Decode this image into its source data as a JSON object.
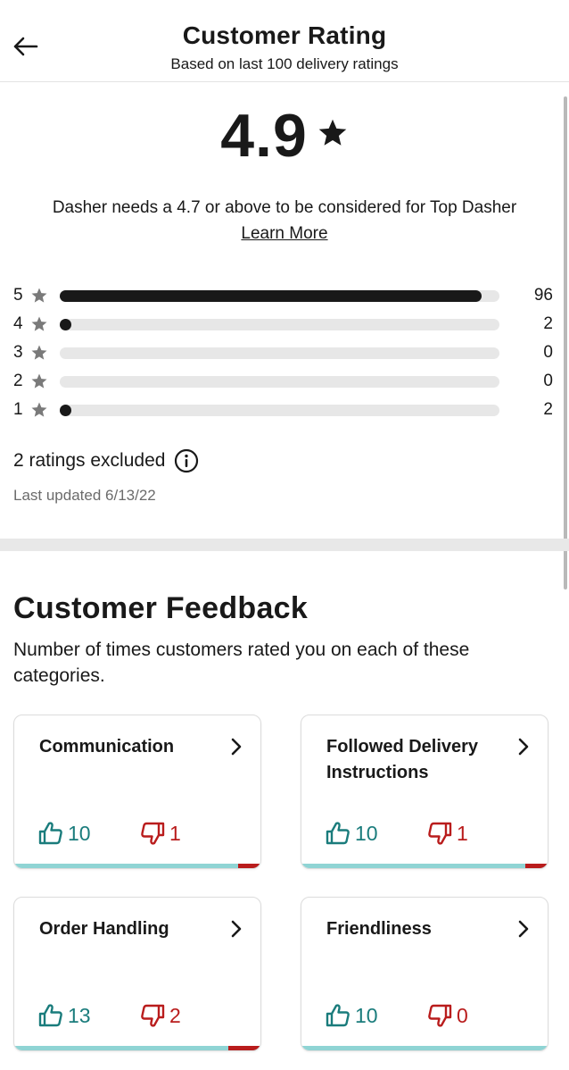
{
  "header": {
    "title": "Customer Rating",
    "subtitle": "Based on last 100 delivery ratings"
  },
  "rating": {
    "value": "4.9",
    "requirement": "Dasher needs a 4.7 or above to be considered for Top Dasher",
    "learn_more": "Learn More"
  },
  "distribution": [
    {
      "stars": "5",
      "count": "96",
      "fraction": 0.96
    },
    {
      "stars": "4",
      "count": "2",
      "fraction": 0.02
    },
    {
      "stars": "3",
      "count": "0",
      "fraction": 0
    },
    {
      "stars": "2",
      "count": "0",
      "fraction": 0
    },
    {
      "stars": "1",
      "count": "2",
      "fraction": 0.02
    }
  ],
  "excluded": "2 ratings excluded",
  "last_updated": "Last updated 6/13/22",
  "feedback": {
    "title": "Customer Feedback",
    "description": "Number of times customers rated you on each of these categories.",
    "cards": [
      {
        "title": "Communication",
        "up": "10",
        "down": "1",
        "neg_fraction": 0.09
      },
      {
        "title": "Followed Delivery Instructions",
        "up": "10",
        "down": "1",
        "neg_fraction": 0.09
      },
      {
        "title": "Order Handling",
        "up": "13",
        "down": "2",
        "neg_fraction": 0.13
      },
      {
        "title": "Friendliness",
        "up": "10",
        "down": "0",
        "neg_fraction": 0
      }
    ]
  },
  "colors": {
    "positive": "#1a7c7c",
    "negative": "#b91c1c",
    "bar_positive": "#8fd4d4"
  }
}
